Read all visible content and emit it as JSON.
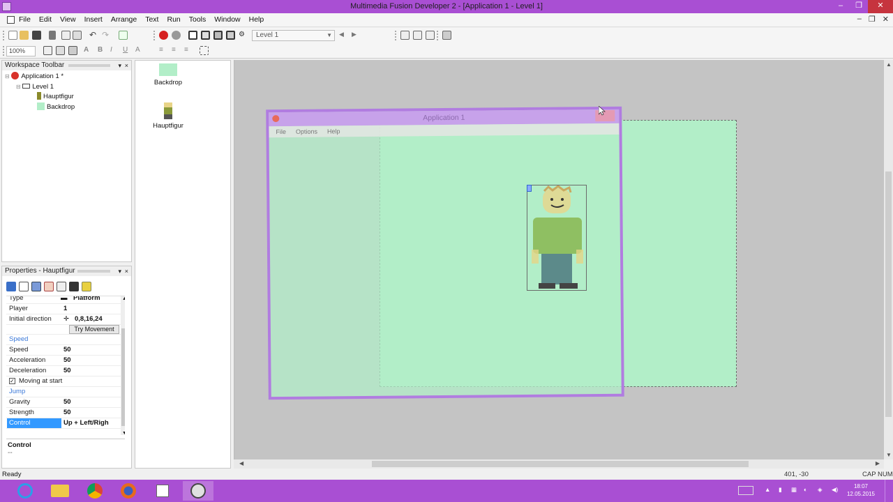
{
  "window": {
    "title": "Multimedia Fusion Developer 2 - [Application 1 - Level 1]",
    "minimize": "–",
    "restore": "❐",
    "close": "✕"
  },
  "menubar": {
    "items": [
      "File",
      "Edit",
      "View",
      "Insert",
      "Arrange",
      "Text",
      "Run",
      "Tools",
      "Window",
      "Help"
    ],
    "mdi_controls": [
      "–",
      "❐",
      "✕"
    ]
  },
  "toolbar": {
    "level_select": "Level 1",
    "zoom": "100%"
  },
  "workspace": {
    "title": "Workspace Toolbar",
    "tree": [
      {
        "label": "Application 1 *",
        "icon": "application-icon",
        "indent": 0
      },
      {
        "label": "Level 1",
        "icon": "frame-icon",
        "indent": 1
      },
      {
        "label": "Hauptfigur",
        "icon": "character-icon",
        "indent": 2
      },
      {
        "label": "Backdrop",
        "icon": "backdrop-icon",
        "indent": 2
      }
    ]
  },
  "object_list": {
    "items": [
      {
        "label": "Backdrop",
        "icon": "backdrop-icon"
      },
      {
        "label": "Hauptfigur",
        "icon": "character-icon"
      }
    ]
  },
  "properties": {
    "title": "Properties - Hauptfigur",
    "rows": [
      {
        "name": "Type",
        "value": "Platform",
        "kind": "prop"
      },
      {
        "name": "Player",
        "value": "1",
        "kind": "prop"
      },
      {
        "name": "Initial direction",
        "value": "0,8,16,24",
        "kind": "prop"
      },
      {
        "name": "",
        "value": "",
        "kind": "button"
      },
      {
        "name": "Speed",
        "value": "",
        "kind": "cat"
      },
      {
        "name": "Speed",
        "value": "50",
        "kind": "prop"
      },
      {
        "name": "Acceleration",
        "value": "50",
        "kind": "prop"
      },
      {
        "name": "Deceleration",
        "value": "50",
        "kind": "prop"
      },
      {
        "name": "Moving at start",
        "value": "",
        "kind": "check"
      },
      {
        "name": "Jump",
        "value": "",
        "kind": "cat"
      },
      {
        "name": "Gravity",
        "value": "50",
        "kind": "prop"
      },
      {
        "name": "Strength",
        "value": "50",
        "kind": "prop"
      },
      {
        "name": "Control",
        "value": "Up + Left/Righ",
        "kind": "sel"
      }
    ],
    "try_movement": "Try Movement",
    "description_title": "Control",
    "description_text": "--"
  },
  "app_preview": {
    "title": "Application 1",
    "menu": [
      "File",
      "Options",
      "Help"
    ]
  },
  "statusbar": {
    "status": "Ready",
    "coords": "401, -30",
    "caps": "CAP",
    "num": "NUM"
  },
  "taskbar": {
    "apps": [
      "internet-explorer-icon",
      "file-explorer-icon",
      "chrome-icon",
      "firefox-icon",
      "notepad-icon",
      "mmf2-icon"
    ],
    "clock_time": "18:07",
    "clock_date": "12.05.2015"
  },
  "colors": {
    "accent": "#a94fd3",
    "backdrop": "#b2eec8",
    "window_border": "#b17ce0"
  }
}
